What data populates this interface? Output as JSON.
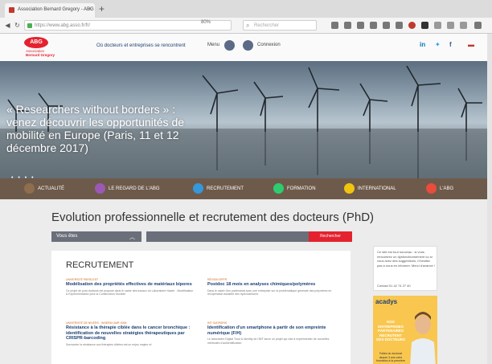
{
  "browser": {
    "tab_title": "Association Bernard Gregory - ABG",
    "new_tab": "+",
    "url": "https://www.abg.asso.fr/fr/",
    "zoom": "80%",
    "search_placeholder": "Rechercher"
  },
  "site": {
    "logo_text": "ABG",
    "logo_line1": "Association",
    "logo_line2": "Bernard Gregory",
    "tagline": "Où docteurs et entreprises se rencontrent",
    "menu_label": "Menu",
    "connexion": "Connexion"
  },
  "hero": {
    "headline": "« Researchers without borders » : venez découvrir les opportunités de mobilité en Europe (Paris, 11 et 12 décembre 2017)",
    "dots": "• • • •"
  },
  "categories": [
    {
      "label": "ACTUALITÉ",
      "color": "#8e6e4e"
    },
    {
      "label": "LE REGARD DE L'ABG",
      "color": "#9b59b6"
    },
    {
      "label": "RECRUTEMENT",
      "color": "#3498db"
    },
    {
      "label": "FORMATION",
      "color": "#2ecc71"
    },
    {
      "label": "INTERNATIONAL",
      "color": "#f1c40f"
    },
    {
      "label": "L'ABG",
      "color": "#e74c3c"
    }
  ],
  "main": {
    "title": "Evolution professionnelle et recrutement des docteurs (PhD)",
    "vos_label": "Vous êtes",
    "search_button": "Rechercher"
  },
  "recruitment": {
    "heading": "RECRUTEMENT",
    "jobs": [
      {
        "category": "UNIVERSITÉ PARIS-EST",
        "title": "Modélisation des propriétés effectives de matériaux bipores",
        "desc": "Ce projet de post-doctorat est proposé dans le cadre des travaux du Laboratoire Navier - Modélisation & Expérimentation pour la Construction Durable"
      },
      {
        "category": "RÉGION EPFR",
        "title": "Postdoc 18 mois en analyses chimiques/polymères",
        "desc": "Dans le cadre d'un partenariat avec une entreprise sur la problématique générale des polymères en récupération assistée des hydrocarbures"
      },
      {
        "category": "UNIVERSITÉ DE NIVERS - INSERM UMR 1068",
        "title": "Résistance à la thérapie ciblée dans le cancer bronchique : identification de nouvelles stratégies thérapeutiques par CRISPR-barcoding",
        "desc": "Surmonter la résistance aux thérapies ciblées est un enjeu majeur et"
      },
      {
        "category": "INT SUDPARIS",
        "title": "Identification d'un smartphone à partir de son empreinte numérique (F/H)",
        "desc": "Le laboratoire Digital Trust & Identity de l'IMT lance un projet qui vise à expérimenter de nouvelles méthodes d'authentification"
      }
    ]
  },
  "sidebar": {
    "notice": "Ce site est tout nouveau : si vous rencontrez un dysfonctionnement ou si vous avez des suggestions, n'hésitez pas à nous en informer. Merci d'avance !",
    "contact": "Contact   01 42 74 27 40",
    "ad_brand": "acadys",
    "ad_text": "NOS ENTREPRISES PARTENAIRES RECRUTENT DES DOCTEURS",
    "ad_footer": "Faites du doctorat depuis 3 ans votre formation à la première journée proposée"
  },
  "colors": {
    "brand_red": "#e4222f",
    "navy": "#1b3f73",
    "category_bar": "#6e5a4a"
  }
}
